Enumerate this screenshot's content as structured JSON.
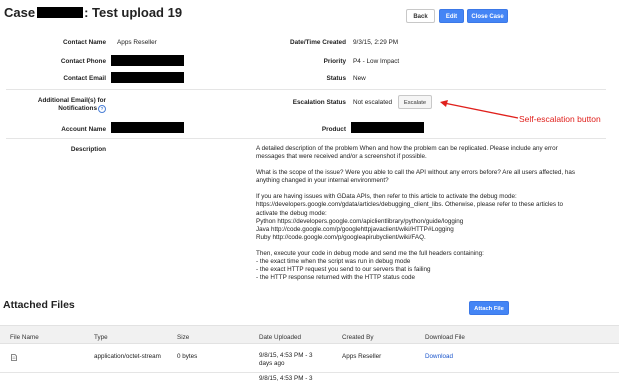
{
  "header": {
    "title_prefix": "Case",
    "title_suffix": ": Test upload 19",
    "back_label": "Back",
    "edit_label": "Edit",
    "close_label": "Close Case"
  },
  "fields": {
    "contact_name_label": "Contact Name",
    "contact_name_value": "Apps Reseller",
    "contact_phone_label": "Contact Phone",
    "contact_email_label": "Contact Email",
    "additional_emails_label": "Additional Email(s) for",
    "additional_emails_label2": "Notifications",
    "help_icon_glyph": "?",
    "account_name_label": "Account Name",
    "date_created_label": "Date/Time Created",
    "date_created_value": "9/3/15, 2:29 PM",
    "priority_label": "Priority",
    "priority_value": "P4 - Low Impact",
    "status_label": "Status",
    "status_value": "New",
    "escalation_status_label": "Escalation Status",
    "escalation_status_value": "Not escalated",
    "escalate_label": "Escalate",
    "product_label": "Product",
    "description_label": "Description"
  },
  "description": {
    "p1": "A detailed description of the problem When and how the problem can be replicated. Please include any error messages that were received and/or a screenshot if possible.",
    "p2": "What is the scope of the issue? Were you able to call the API without any errors before? Are all users affected, has anything changed in your internal environment?",
    "p3_1": "If you are having issues with GData APIs, then refer to this article to activate the debug mode:",
    "p3_2": "https://developers.google.com/gdata/articles/debugging_client_libs. Otherwise, please refer to these articles to activate the debug mode:",
    "p3_3": "Python https://developers.google.com/apiclientlibrary/python/guide/logging",
    "p3_4": "Java http://code.google.com/p/googlehttpjavaclient/wiki/HTTP#Logging",
    "p3_5": "Ruby http://code.google.com/p/googleapirubyclient/wiki/FAQ.",
    "p4_1": "Then, execute your code in debug mode and send me the full headers containing:",
    "p4_2": "- the exact time when the script was run in debug mode",
    "p4_3": "- the exact HTTP request you send to our servers that is failing",
    "p4_4": "- the HTTP response returned with the HTTP status code"
  },
  "files": {
    "section_title": "Attached Files",
    "attach_label": "Attach File",
    "columns": [
      "File Name",
      "Type",
      "Size",
      "Date Uploaded",
      "Created By",
      "Download File"
    ],
    "rows": [
      {
        "icon": "file-icon",
        "type": "application/octet-stream",
        "size": "0 bytes",
        "date_line1": "9/8/15, 4:53 PM - 3",
        "date_line2": "days ago",
        "created_by": "Apps Reseller",
        "download": "Download"
      },
      {
        "date_line1": "9/8/15, 4:53 PM - 3"
      }
    ]
  },
  "annotation": {
    "label": "Self-escalation button",
    "color": "#e0201c"
  },
  "colors": {
    "primary_button": "#4485f5",
    "link": "#1a55cc"
  }
}
